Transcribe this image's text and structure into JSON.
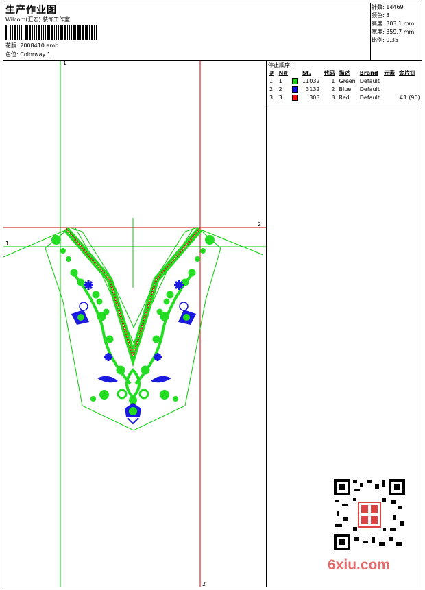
{
  "header": {
    "title": "生产作业图",
    "company": "Wilcom(汇宏) 装饰工作室",
    "design_label": "花版:",
    "design_value": "2008410.emb",
    "color_label": "色位:",
    "color_value": "Colorway 1"
  },
  "stats": [
    {
      "label": "针数:",
      "value": "14469"
    },
    {
      "label": "颜色:",
      "value": "3"
    },
    {
      "label": "高度:",
      "value": "303.1 mm"
    },
    {
      "label": "宽度:",
      "value": "359.7 mm"
    },
    {
      "label": "比例:",
      "value": "0.35"
    }
  ],
  "stop_sequence": {
    "title": "停止顺序:",
    "headers": [
      "#",
      "N#",
      "St.",
      "代码",
      "描述",
      "Brand",
      "元素",
      "金片钉"
    ],
    "rows": [
      {
        "idx": "1.",
        "n": "1",
        "color": "#22cc22",
        "st": "11032",
        "code": "1",
        "desc": "Green",
        "brand": "Default",
        "element": "",
        "sequin": ""
      },
      {
        "idx": "2.",
        "n": "2",
        "color": "#1111dd",
        "st": "3132",
        "code": "2",
        "desc": "Blue",
        "brand": "Default",
        "element": "",
        "sequin": ""
      },
      {
        "idx": "3.",
        "n": "3",
        "color": "#ee1111",
        "st": "303",
        "code": "3",
        "desc": "Red",
        "brand": "Default",
        "element": "",
        "sequin": "#1 (90)"
      }
    ]
  },
  "grid_labels": {
    "v1": "1",
    "v2": "2",
    "h1": "1",
    "h2": "2"
  },
  "colors": {
    "green": "#22dd22",
    "blue": "#1a1ae0",
    "red": "#dd1111",
    "frame_green": "#00cc00",
    "frame_red": "#cc0000"
  },
  "watermark": "6xiu.com"
}
